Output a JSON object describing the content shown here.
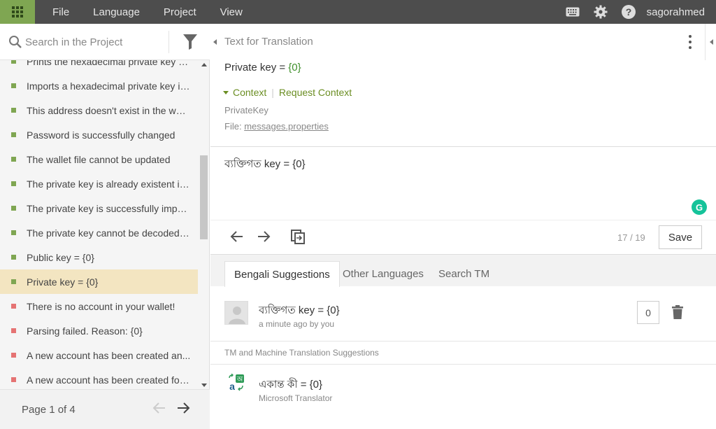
{
  "topbar": {
    "menu": [
      "File",
      "Language",
      "Project",
      "View"
    ],
    "username": "sagorahmed",
    "icons": [
      "apps-grid-icon",
      "keyboard-icon",
      "gear-icon",
      "help-icon"
    ]
  },
  "sidebar": {
    "search_placeholder": "Search in the Project",
    "items": [
      {
        "label": "Prints the hexadecimal private key o...",
        "status": "translated"
      },
      {
        "label": "Imports a hexadecimal private key in...",
        "status": "translated"
      },
      {
        "label": "This address doesn't exist in the wallet",
        "status": "translated"
      },
      {
        "label": "Password is successfully changed",
        "status": "translated"
      },
      {
        "label": "The wallet file cannot be updated",
        "status": "translated"
      },
      {
        "label": "The private key is already existent in ...",
        "status": "translated"
      },
      {
        "label": "The private key is successfully impor...",
        "status": "translated"
      },
      {
        "label": "The private key cannot be decoded: ...",
        "status": "translated"
      },
      {
        "label": "Public key = {0}",
        "status": "translated"
      },
      {
        "label": "Private key = {0}",
        "status": "translated",
        "active": true
      },
      {
        "label": "There is no account in your wallet!",
        "status": "untranslated"
      },
      {
        "label": "Parsing failed. Reason: {0}",
        "status": "untranslated"
      },
      {
        "label": "A new account has been created an...",
        "status": "untranslated"
      },
      {
        "label": "A new account has been created for ...",
        "status": "untranslated"
      }
    ],
    "page_label": "Page 1 of 4"
  },
  "editor": {
    "source_title": "Text for Translation",
    "source_prefix": "Private key = ",
    "source_placeholder": "{0}",
    "context_label": "Context",
    "request_context_label": "Request Context",
    "context_key": "PrivateKey",
    "file_label": "File:",
    "file_name": "messages.properties",
    "translation": "ব্যক্তিগত key = {0}",
    "grammarly_letter": "G",
    "counter": "17 / 19",
    "save_label": "Save"
  },
  "suggestions": {
    "tabs": [
      "Bengali Suggestions",
      "Other Languages",
      "Search TM"
    ],
    "user_suggestion": {
      "text": "ব্যক্তিগত key = {0}",
      "meta": "a minute ago by you",
      "votes": "0"
    },
    "tm_title": "TM and Machine Translation Suggestions",
    "machine": {
      "text": "একান্ত কী = {0}",
      "source": "Microsoft Translator"
    }
  },
  "colors": {
    "topbar": "#4d4d4d",
    "accent_green": "#7fa652",
    "untranslated_red": "#e57373",
    "active_row": "#f3e5c1"
  }
}
